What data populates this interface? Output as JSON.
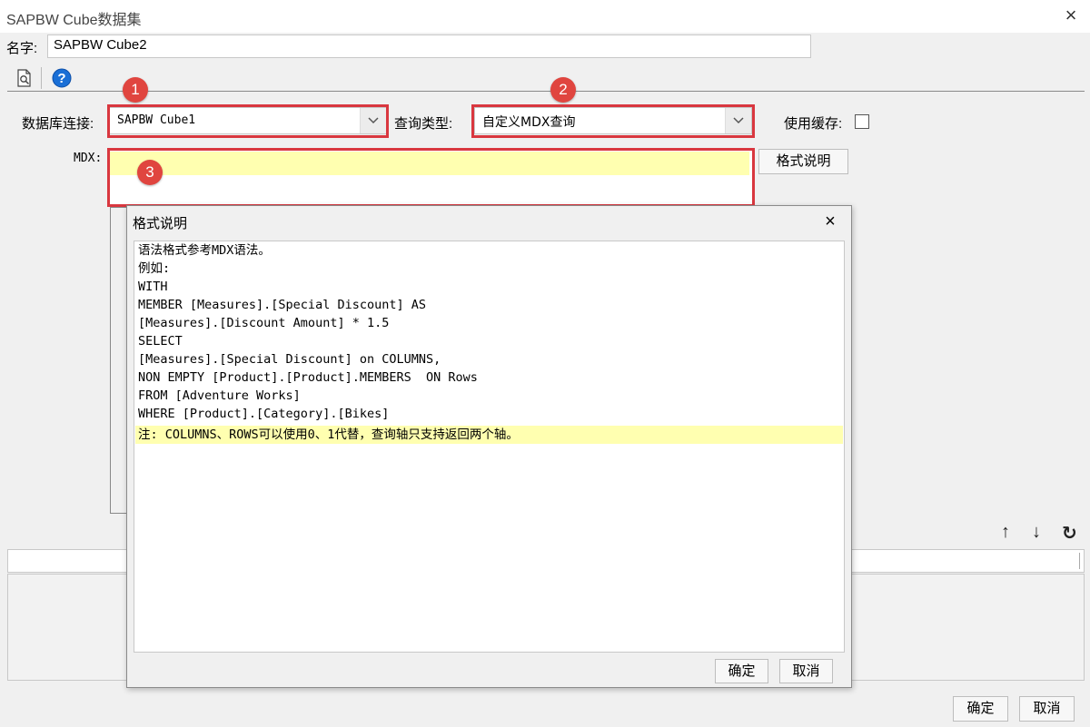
{
  "window": {
    "title": "SAPBW Cube数据集",
    "close_icon": "×"
  },
  "name_field": {
    "label": "名字:",
    "value": "SAPBW Cube2"
  },
  "toolbar": {
    "preview_icon": "preview-icon",
    "help_icon": "help-icon",
    "help_glyph": "?"
  },
  "db_connection": {
    "label": "数据库连接:",
    "value": "SAPBW Cube1",
    "badge": "1"
  },
  "query_type": {
    "label": "查询类型:",
    "value": "自定义MDX查询",
    "badge": "2"
  },
  "use_cache": {
    "label": "使用缓存:",
    "checked": false
  },
  "mdx": {
    "label": "MDX:",
    "value": "",
    "badge": "3",
    "format_button": "格式说明"
  },
  "refresh_icons": {
    "up": "↑",
    "down": "↓",
    "refresh": "↻"
  },
  "dialog": {
    "title": "格式说明",
    "close_icon": "×",
    "lines": [
      "语法格式参考MDX语法。",
      "例如:",
      "WITH",
      "MEMBER [Measures].[Special Discount] AS",
      "[Measures].[Discount Amount] * 1.5",
      "SELECT",
      "[Measures].[Special Discount] on COLUMNS,",
      "NON EMPTY [Product].[Product].MEMBERS  ON Rows",
      "FROM [Adventure Works]",
      "WHERE [Product].[Category].[Bikes]",
      "注: COLUMNS、ROWS可以使用0、1代替，查询轴只支持返回两个轴。"
    ],
    "ok_button": "确定",
    "cancel_button": "取消"
  },
  "footer": {
    "ok_button": "确定",
    "cancel_button": "取消"
  },
  "colors": {
    "annotation_red": "#d9373f",
    "highlight_yellow": "#ffffb0",
    "help_blue": "#1a6fd6"
  }
}
